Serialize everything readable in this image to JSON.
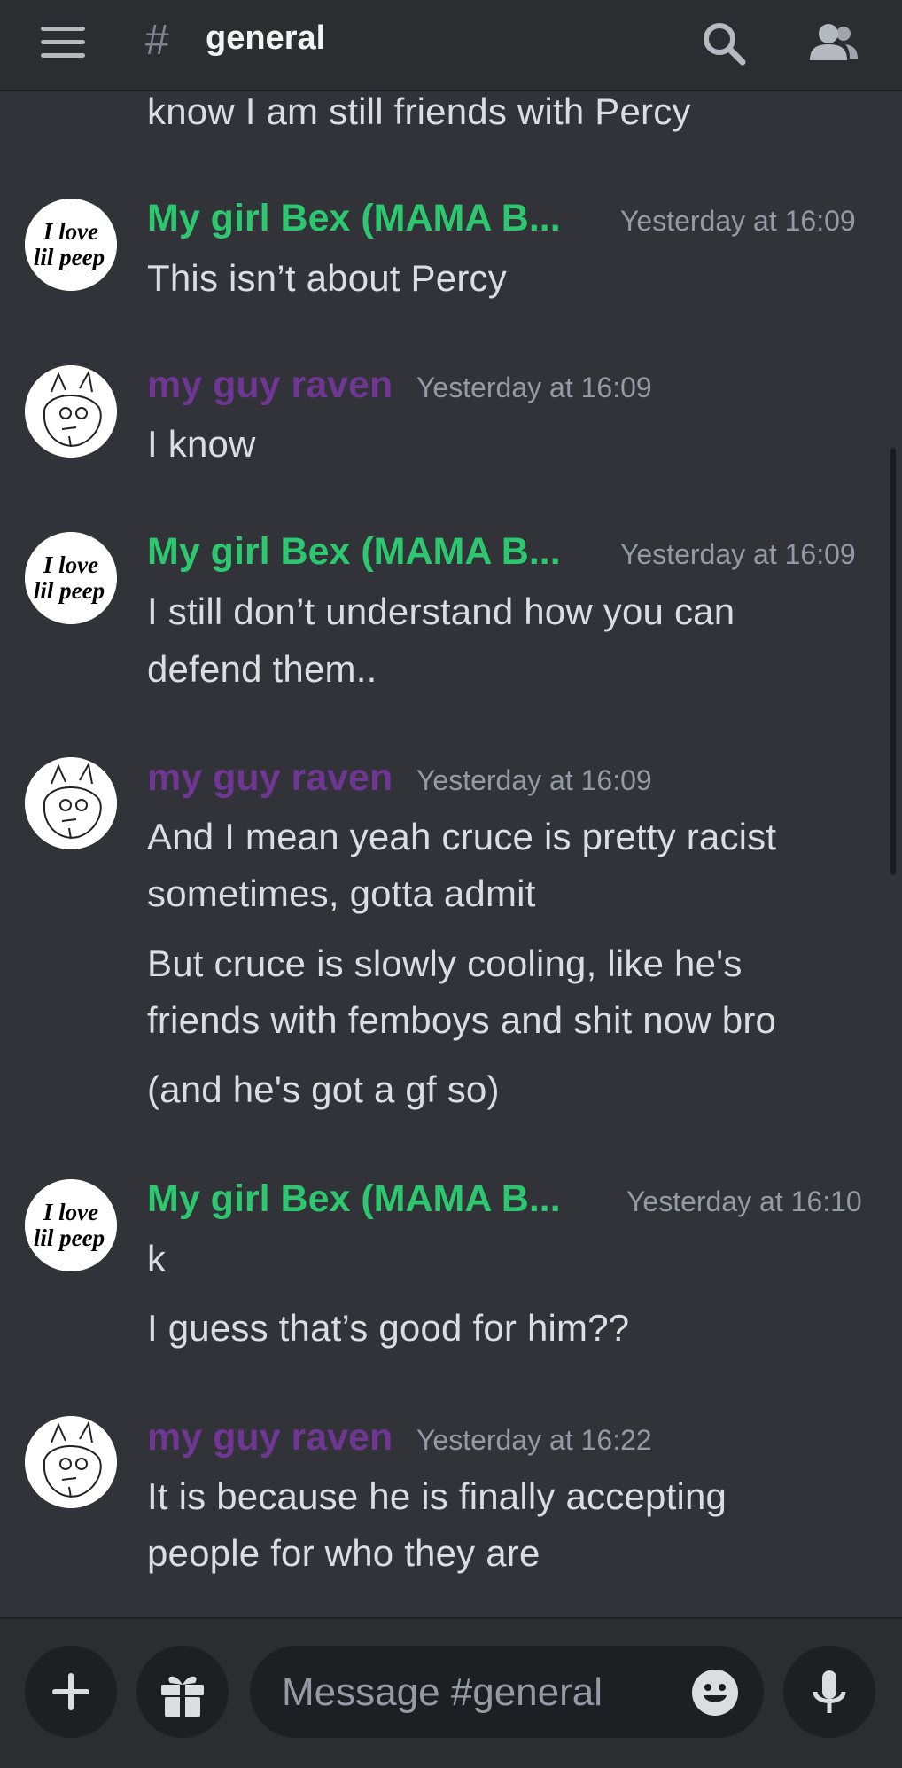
{
  "header": {
    "channel_prefix": "#",
    "channel_name": "general",
    "menu_icon": "hamburger-menu-icon",
    "search_icon": "search-icon",
    "members_icon": "members-icon"
  },
  "colors": {
    "background": "#313338",
    "header": "#2b2d31",
    "bex_name": "#2dc770",
    "raven_name": "#6f3693",
    "timestamp": "#949ba4",
    "message_text": "#dbdee1"
  },
  "chat": {
    "partial_message": "know I am still friends with Percy",
    "messages": [
      {
        "author": "My girl Bex (MAMA B...",
        "avatar_text_line1": "I love",
        "avatar_text_line2": "lil peep",
        "timestamp": "Yesterday at 16:09",
        "lines": [
          "This isn’t about Percy"
        ]
      },
      {
        "author": "my guy raven",
        "avatar_text_line1": "",
        "avatar_text_line2": "",
        "timestamp": "Yesterday at 16:09",
        "lines": [
          "I know"
        ]
      },
      {
        "author": "My girl Bex (MAMA B...",
        "avatar_text_line1": "I love",
        "avatar_text_line2": "lil peep",
        "timestamp": "Yesterday at 16:09",
        "lines": [
          "I still don’t understand how you can",
          "defend them.."
        ]
      },
      {
        "author": "my guy raven",
        "avatar_text_line1": "",
        "avatar_text_line2": "",
        "timestamp": "Yesterday at 16:09",
        "lines": [
          "And I mean yeah cruce is pretty racist",
          "sometimes, gotta admit"
        ],
        "followups": [
          [
            "But cruce is slowly cooling, like he's",
            "friends with femboys and shit now bro"
          ],
          [
            "(and he's got a gf so)"
          ]
        ]
      },
      {
        "author": "My girl Bex (MAMA B...",
        "avatar_text_line1": "I love",
        "avatar_text_line2": "lil peep",
        "timestamp": "Yesterday at 16:10",
        "lines": [
          "k"
        ],
        "followups": [
          [
            "I guess that’s good for him??"
          ]
        ]
      },
      {
        "author": "my guy raven",
        "avatar_text_line1": "",
        "avatar_text_line2": "",
        "timestamp": "Yesterday at 16:22",
        "lines": [
          "It is because he is finally accepting",
          "people for who they are"
        ]
      }
    ]
  },
  "composer": {
    "placeholder": "Message #general",
    "plus_icon": "plus-icon",
    "gift_icon": "gift-icon",
    "emoji_icon": "emoji-icon",
    "mic_icon": "microphone-icon"
  }
}
